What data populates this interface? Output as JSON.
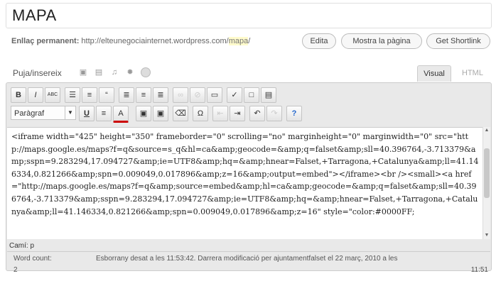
{
  "post": {
    "title": "MAPA"
  },
  "permalink": {
    "label": "Enllaç permanent:",
    "url_base": "http://elteunegociainternet.wordpress.com/",
    "slug": "mapa",
    "url_end": "/",
    "edit_label": "Edita",
    "view_label": "Mostra la pàgina",
    "shortlink_label": "Get Shortlink"
  },
  "media": {
    "upload_label": "Puja/insereix",
    "icons": [
      "image-icon",
      "video-icon",
      "audio-icon",
      "media-icon",
      "circle-icon"
    ]
  },
  "tabs": {
    "visual": "Visual",
    "html": "HTML"
  },
  "toolbar": {
    "row1": [
      {
        "name": "bold-button",
        "glyph": "B"
      },
      {
        "name": "italic-button",
        "glyph": "I"
      },
      {
        "name": "strikethrough-button",
        "glyph": "ABC"
      },
      {
        "name": "bullet-list-button",
        "glyph": "☰"
      },
      {
        "name": "numbered-list-button",
        "glyph": "≡"
      },
      {
        "name": "blockquote-button",
        "glyph": "“"
      },
      {
        "name": "align-left-button",
        "glyph": "≣"
      },
      {
        "name": "align-center-button",
        "glyph": "≡"
      },
      {
        "name": "align-right-button",
        "glyph": "≣"
      },
      {
        "name": "insert-link-button",
        "glyph": "∞"
      },
      {
        "name": "unlink-button",
        "glyph": "⊘"
      },
      {
        "name": "more-tag-button",
        "glyph": "▭"
      },
      {
        "name": "spellcheck-button",
        "glyph": "✓"
      },
      {
        "name": "fullscreen-button",
        "glyph": "□"
      },
      {
        "name": "kitchen-sink-button",
        "glyph": "▤"
      }
    ],
    "format_select": "Paràgraf",
    "row2": [
      {
        "name": "underline-button",
        "glyph": "U"
      },
      {
        "name": "justify-button",
        "glyph": "≡"
      },
      {
        "name": "text-color-button",
        "glyph": "A"
      },
      {
        "name": "paste-text-button",
        "glyph": "▣"
      },
      {
        "name": "paste-word-button",
        "glyph": "▣"
      },
      {
        "name": "remove-format-button",
        "glyph": "⌫"
      },
      {
        "name": "special-char-button",
        "glyph": "Ω"
      },
      {
        "name": "outdent-button",
        "glyph": "⇤"
      },
      {
        "name": "indent-button",
        "glyph": "⇥"
      },
      {
        "name": "undo-button",
        "glyph": "↶"
      },
      {
        "name": "redo-button",
        "glyph": "↷"
      },
      {
        "name": "help-button",
        "glyph": "?"
      }
    ]
  },
  "editor": {
    "content": "<iframe width=\"425\" height=\"350\" frameborder=\"0\" scrolling=\"no\" marginheight=\"0\" marginwidth=\"0\" src=\"http://maps.google.es/maps?f=q&source=s_q&hl=ca&amp;geocode=&amp;q=falset&amp;sll=40.396764,-3.713379&amp;sspn=9.283294,17.094727&amp;ie=UTF8&amp;hq=&amp;hnear=Falset,+Tarragona,+Catalunya&amp;ll=41.146334,0.821266&amp;spn=0.009049,0.017896&amp;z=16&amp;output=embed\"></iframe><br /><small><a href=\"http://maps.google.es/maps?f=q&amp;source=embed&amp;hl=ca&amp;geocode=&amp;q=falset&amp;sll=40.396764,-3.713379&amp;sspn=9.283294,17.094727&amp;ie=UTF8&amp;hq=&amp;hnear=Falset,+Tarragona,+Catalunya&amp;ll=41.146334,0.821266&amp;spn=0.009049,0.017896&amp;z=16\" style=\"color:#0000FF;",
    "path_label": "Camí: p"
  },
  "status": {
    "word_count_label": "Word count:",
    "word_count": "2",
    "draft_saved": "Esborrany desat a les 11:53:42. Darrera modificació per ajuntamentfalset el 22 març, 2010 a les",
    "draft_time": "11:51"
  }
}
